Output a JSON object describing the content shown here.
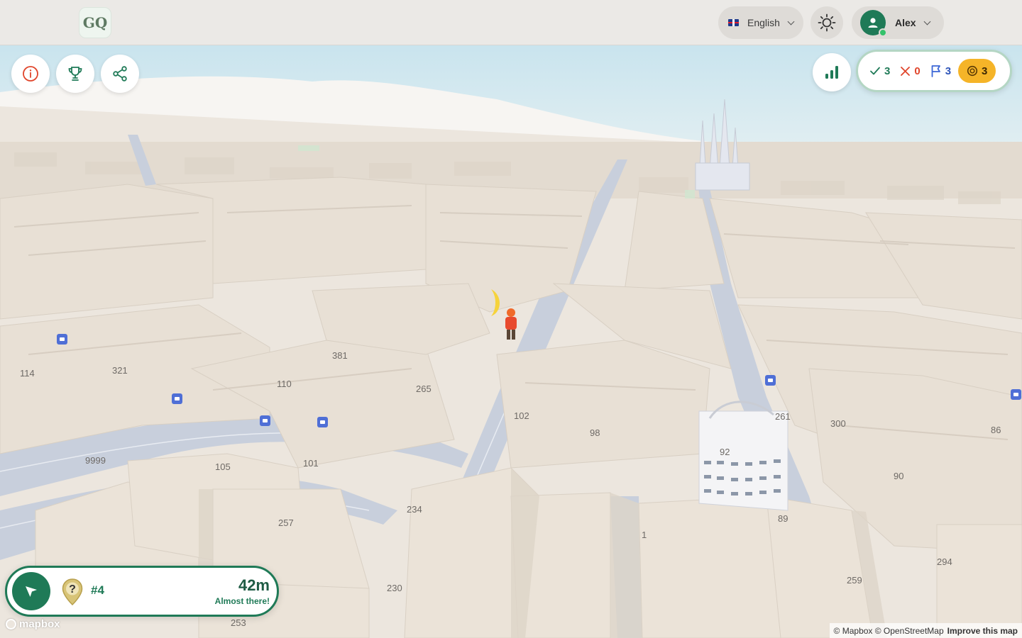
{
  "header": {
    "logo_text": "GQ",
    "language": "English",
    "user_name": "Alex"
  },
  "toolbar": {
    "icons": [
      "info-icon",
      "trophy-icon",
      "share-icon"
    ]
  },
  "score": {
    "correct": "3",
    "wrong": "0",
    "flags": "3",
    "coins": "3"
  },
  "target": {
    "number": "#4",
    "distance": "42m",
    "hint": "Almost there!",
    "pin_symbol": "?"
  },
  "map": {
    "block_labels": [
      "114",
      "321",
      "381",
      "110",
      "265",
      "102",
      "98",
      "261",
      "300",
      "86",
      "92",
      "90",
      "9999",
      "105",
      "101",
      "234",
      "257",
      "89",
      "1",
      "294",
      "230",
      "259",
      "253"
    ],
    "attribution_left": "© Mapbox © OpenStreetMap",
    "attribution_link": "Improve this map",
    "brand": "mapbox"
  },
  "colors": {
    "primary": "#1f7a57",
    "coin": "#f5b428",
    "wrong": "#e0452b",
    "building": "#e9e2d8",
    "road": "#c7cedd"
  }
}
